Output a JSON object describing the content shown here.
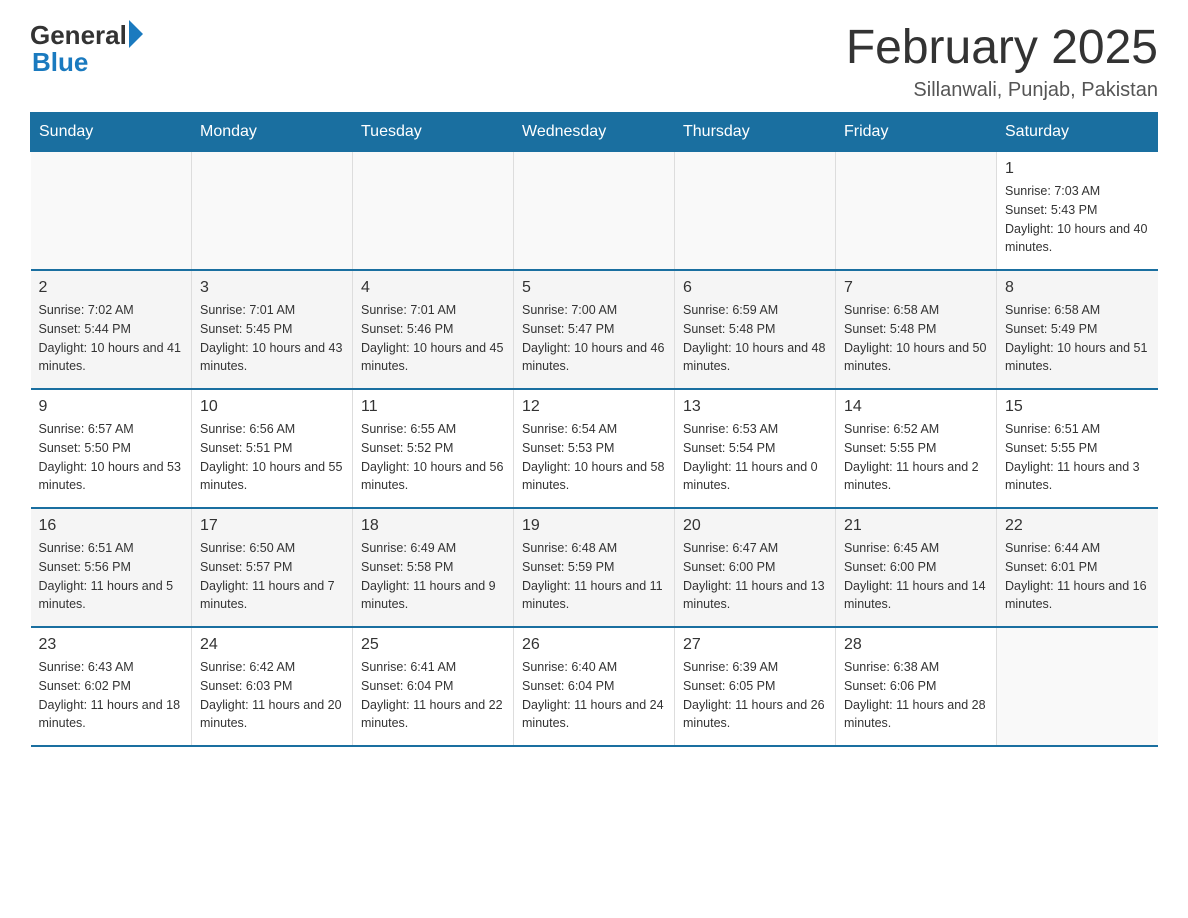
{
  "header": {
    "logo_general": "General",
    "logo_blue": "Blue",
    "month_title": "February 2025",
    "location": "Sillanwali, Punjab, Pakistan"
  },
  "days_of_week": [
    "Sunday",
    "Monday",
    "Tuesday",
    "Wednesday",
    "Thursday",
    "Friday",
    "Saturday"
  ],
  "weeks": [
    [
      {
        "day": "",
        "info": ""
      },
      {
        "day": "",
        "info": ""
      },
      {
        "day": "",
        "info": ""
      },
      {
        "day": "",
        "info": ""
      },
      {
        "day": "",
        "info": ""
      },
      {
        "day": "",
        "info": ""
      },
      {
        "day": "1",
        "info": "Sunrise: 7:03 AM\nSunset: 5:43 PM\nDaylight: 10 hours and 40 minutes."
      }
    ],
    [
      {
        "day": "2",
        "info": "Sunrise: 7:02 AM\nSunset: 5:44 PM\nDaylight: 10 hours and 41 minutes."
      },
      {
        "day": "3",
        "info": "Sunrise: 7:01 AM\nSunset: 5:45 PM\nDaylight: 10 hours and 43 minutes."
      },
      {
        "day": "4",
        "info": "Sunrise: 7:01 AM\nSunset: 5:46 PM\nDaylight: 10 hours and 45 minutes."
      },
      {
        "day": "5",
        "info": "Sunrise: 7:00 AM\nSunset: 5:47 PM\nDaylight: 10 hours and 46 minutes."
      },
      {
        "day": "6",
        "info": "Sunrise: 6:59 AM\nSunset: 5:48 PM\nDaylight: 10 hours and 48 minutes."
      },
      {
        "day": "7",
        "info": "Sunrise: 6:58 AM\nSunset: 5:48 PM\nDaylight: 10 hours and 50 minutes."
      },
      {
        "day": "8",
        "info": "Sunrise: 6:58 AM\nSunset: 5:49 PM\nDaylight: 10 hours and 51 minutes."
      }
    ],
    [
      {
        "day": "9",
        "info": "Sunrise: 6:57 AM\nSunset: 5:50 PM\nDaylight: 10 hours and 53 minutes."
      },
      {
        "day": "10",
        "info": "Sunrise: 6:56 AM\nSunset: 5:51 PM\nDaylight: 10 hours and 55 minutes."
      },
      {
        "day": "11",
        "info": "Sunrise: 6:55 AM\nSunset: 5:52 PM\nDaylight: 10 hours and 56 minutes."
      },
      {
        "day": "12",
        "info": "Sunrise: 6:54 AM\nSunset: 5:53 PM\nDaylight: 10 hours and 58 minutes."
      },
      {
        "day": "13",
        "info": "Sunrise: 6:53 AM\nSunset: 5:54 PM\nDaylight: 11 hours and 0 minutes."
      },
      {
        "day": "14",
        "info": "Sunrise: 6:52 AM\nSunset: 5:55 PM\nDaylight: 11 hours and 2 minutes."
      },
      {
        "day": "15",
        "info": "Sunrise: 6:51 AM\nSunset: 5:55 PM\nDaylight: 11 hours and 3 minutes."
      }
    ],
    [
      {
        "day": "16",
        "info": "Sunrise: 6:51 AM\nSunset: 5:56 PM\nDaylight: 11 hours and 5 minutes."
      },
      {
        "day": "17",
        "info": "Sunrise: 6:50 AM\nSunset: 5:57 PM\nDaylight: 11 hours and 7 minutes."
      },
      {
        "day": "18",
        "info": "Sunrise: 6:49 AM\nSunset: 5:58 PM\nDaylight: 11 hours and 9 minutes."
      },
      {
        "day": "19",
        "info": "Sunrise: 6:48 AM\nSunset: 5:59 PM\nDaylight: 11 hours and 11 minutes."
      },
      {
        "day": "20",
        "info": "Sunrise: 6:47 AM\nSunset: 6:00 PM\nDaylight: 11 hours and 13 minutes."
      },
      {
        "day": "21",
        "info": "Sunrise: 6:45 AM\nSunset: 6:00 PM\nDaylight: 11 hours and 14 minutes."
      },
      {
        "day": "22",
        "info": "Sunrise: 6:44 AM\nSunset: 6:01 PM\nDaylight: 11 hours and 16 minutes."
      }
    ],
    [
      {
        "day": "23",
        "info": "Sunrise: 6:43 AM\nSunset: 6:02 PM\nDaylight: 11 hours and 18 minutes."
      },
      {
        "day": "24",
        "info": "Sunrise: 6:42 AM\nSunset: 6:03 PM\nDaylight: 11 hours and 20 minutes."
      },
      {
        "day": "25",
        "info": "Sunrise: 6:41 AM\nSunset: 6:04 PM\nDaylight: 11 hours and 22 minutes."
      },
      {
        "day": "26",
        "info": "Sunrise: 6:40 AM\nSunset: 6:04 PM\nDaylight: 11 hours and 24 minutes."
      },
      {
        "day": "27",
        "info": "Sunrise: 6:39 AM\nSunset: 6:05 PM\nDaylight: 11 hours and 26 minutes."
      },
      {
        "day": "28",
        "info": "Sunrise: 6:38 AM\nSunset: 6:06 PM\nDaylight: 11 hours and 28 minutes."
      },
      {
        "day": "",
        "info": ""
      }
    ]
  ]
}
